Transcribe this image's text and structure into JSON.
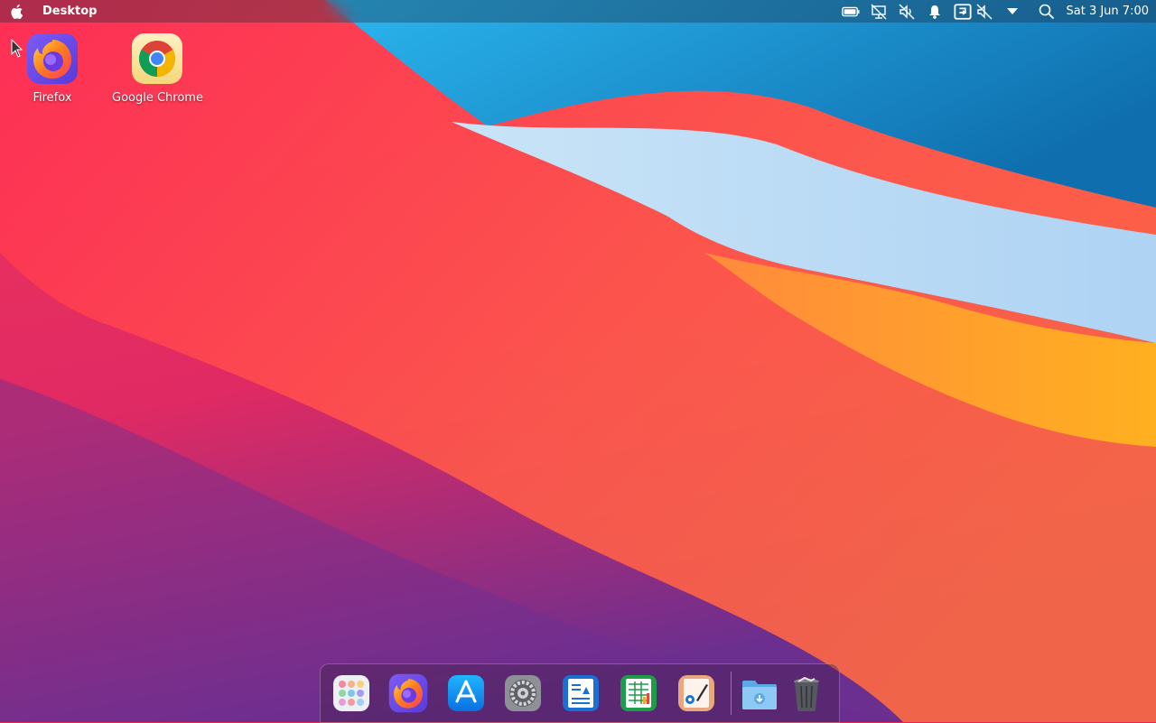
{
  "menubar": {
    "app_title": "Desktop",
    "clock": "Sat 3 Jun 7:00",
    "tray_icons": [
      "battery-icon",
      "network-off-icon",
      "volume-muted-icon",
      "notification-bell-icon",
      "screen-share-icon",
      "mic-muted-icon",
      "dropdown-arrow-icon",
      "search-icon"
    ]
  },
  "desktop": {
    "icons": [
      {
        "label": "Firefox",
        "icon": "firefox-icon"
      },
      {
        "label": "Google Chrome",
        "icon": "chrome-icon"
      }
    ]
  },
  "dock": {
    "items": [
      "launchpad-icon",
      "firefox-icon",
      "app-store-icon",
      "system-preferences-icon",
      "text-editor-icon",
      "spreadsheet-icon",
      "image-editor-icon",
      "downloads-folder-icon",
      "trash-icon"
    ]
  }
}
